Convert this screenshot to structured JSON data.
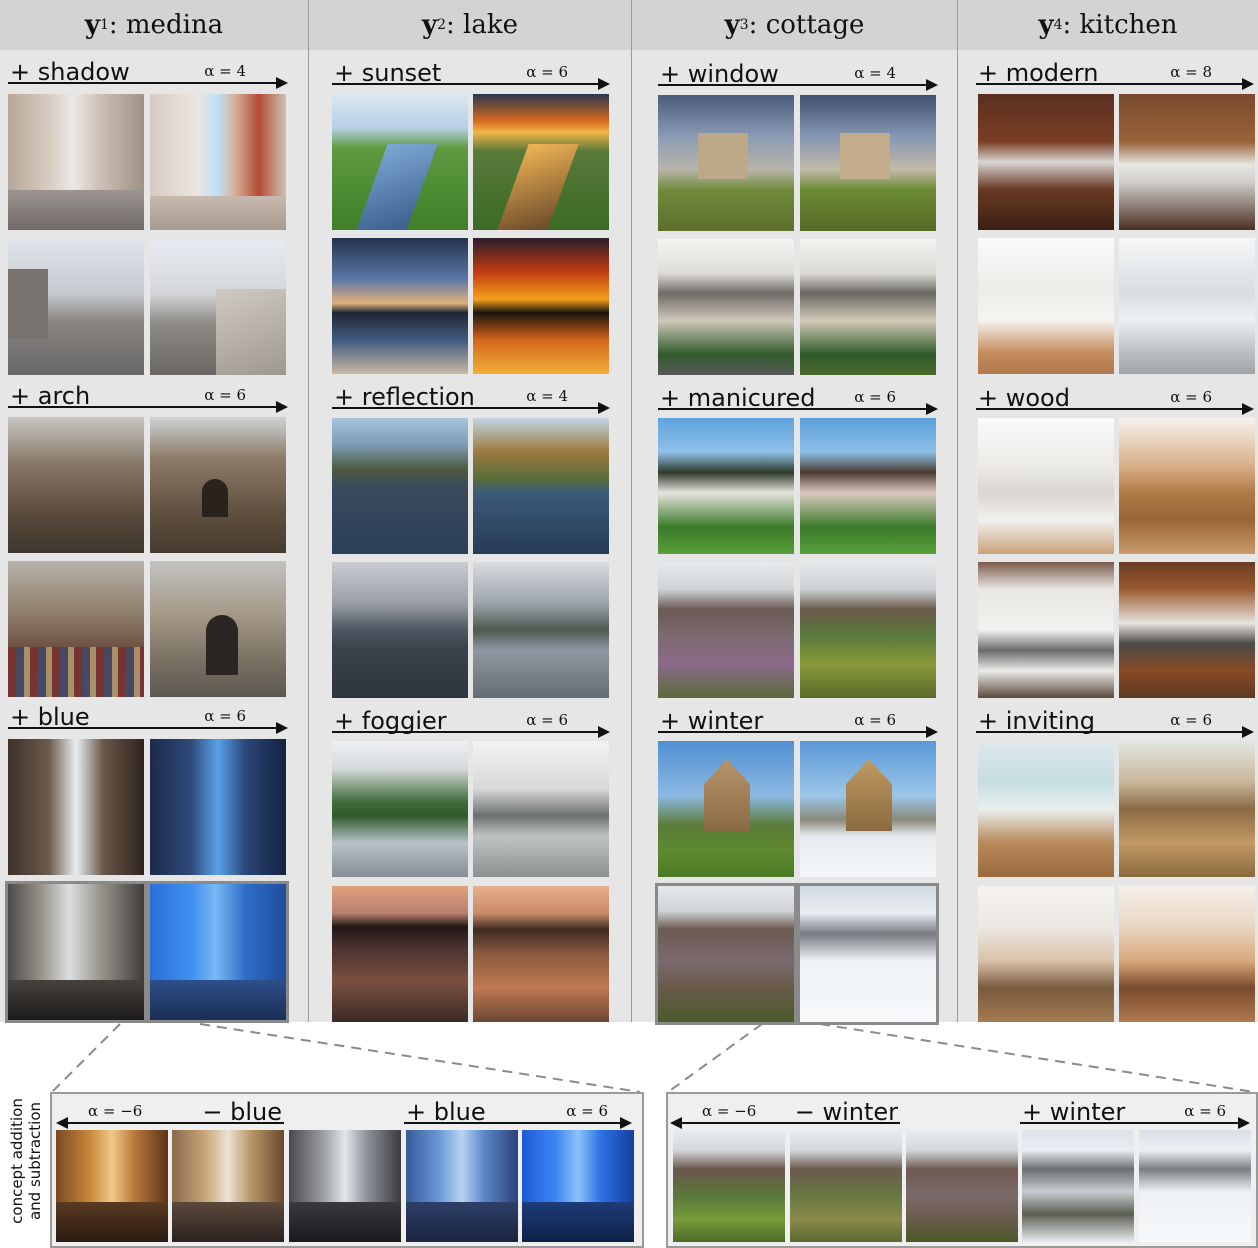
{
  "columns": [
    {
      "var": "y",
      "sub": "1",
      "word": "medina"
    },
    {
      "var": "y",
      "sub": "2",
      "word": "lake"
    },
    {
      "var": "y",
      "sub": "3",
      "word": "cottage"
    },
    {
      "var": "y",
      "sub": "4",
      "word": "kitchen"
    }
  ],
  "concepts": [
    [
      {
        "label": "+ shadow",
        "alpha": "α = 4"
      },
      {
        "label": "+ arch",
        "alpha": "α = 6"
      },
      {
        "label": "+ blue",
        "alpha": "α = 6"
      }
    ],
    [
      {
        "label": "+ sunset",
        "alpha": "α = 6"
      },
      {
        "label": "+ reflection",
        "alpha": "α = 4"
      },
      {
        "label": "+ foggier",
        "alpha": "α = 6"
      }
    ],
    [
      {
        "label": "+ window",
        "alpha": "α = 4"
      },
      {
        "label": "+ manicured",
        "alpha": "α = 6"
      },
      {
        "label": "+ winter",
        "alpha": "α = 6"
      }
    ],
    [
      {
        "label": "+ modern",
        "alpha": "α = 8"
      },
      {
        "label": "+ wood",
        "alpha": "α = 6"
      },
      {
        "label": "+ inviting",
        "alpha": "α = 6"
      }
    ]
  ],
  "bottom": {
    "side_label_line1": "concept addition",
    "side_label_line2": "and subtraction",
    "left": {
      "minus_alpha": "α = −6",
      "minus_label": "− blue",
      "plus_label": "+ blue",
      "plus_alpha": "α = 6"
    },
    "right": {
      "minus_alpha": "α = −6",
      "minus_label": "− winter",
      "plus_label": "+ winter",
      "plus_alpha": "α = 6"
    }
  },
  "colors": {
    "column_bg": "#e6e6e6",
    "header_bg": "#d3d3d3",
    "highlight": "#8a8a8a"
  }
}
